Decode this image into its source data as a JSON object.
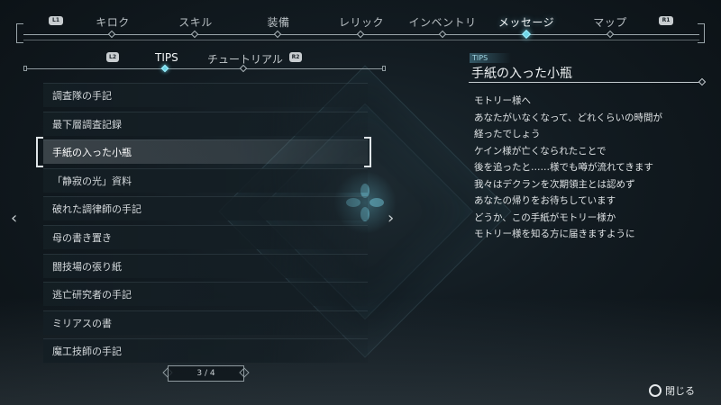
{
  "top_tabs": {
    "left_hint": "L1",
    "right_hint": "R1",
    "items": [
      {
        "label": "キロク"
      },
      {
        "label": "スキル"
      },
      {
        "label": "装備"
      },
      {
        "label": "レリック"
      },
      {
        "label": "インベントリ"
      },
      {
        "label": "メッセージ"
      },
      {
        "label": "マップ"
      }
    ],
    "active": "メッセージ"
  },
  "sub_tabs": {
    "left_hint": "L2",
    "right_hint": "R2",
    "items": [
      {
        "label": "TIPS"
      },
      {
        "label": "チュートリアル"
      }
    ],
    "active": "TIPS"
  },
  "message_list": {
    "items": [
      "調査隊の手記",
      "最下層調査記録",
      "手紙の入った小瓶",
      "「静寂の光」資料",
      "破れた調律師の手記",
      "母の書き置き",
      "闘技場の張り紙",
      "逃亡研究者の手記",
      "ミリアスの書",
      "魔工技師の手記"
    ],
    "selected": "手紙の入った小瓶",
    "page": "3 / 4"
  },
  "detail": {
    "category": "TIPS",
    "title": "手紙の入った小瓶",
    "lines": [
      "モトリー様へ",
      "あなたがいなくなって、どれくらいの時間が",
      "経ったでしょう",
      "ケイン様が亡くなられたことで",
      "後を追ったと……様でも噂が流れてきます",
      "我々はデクランを次期領主とは認めず",
      "あなたの帰りをお待ちしています",
      "どうか、この手紙がモトリー様か",
      "モトリー様を知る方に届きますように"
    ]
  },
  "footer": {
    "close_label": "閉じる",
    "close_icon": "circle-button-icon"
  },
  "colors": {
    "accent": "#6fd6e8",
    "background": "#121b21"
  }
}
